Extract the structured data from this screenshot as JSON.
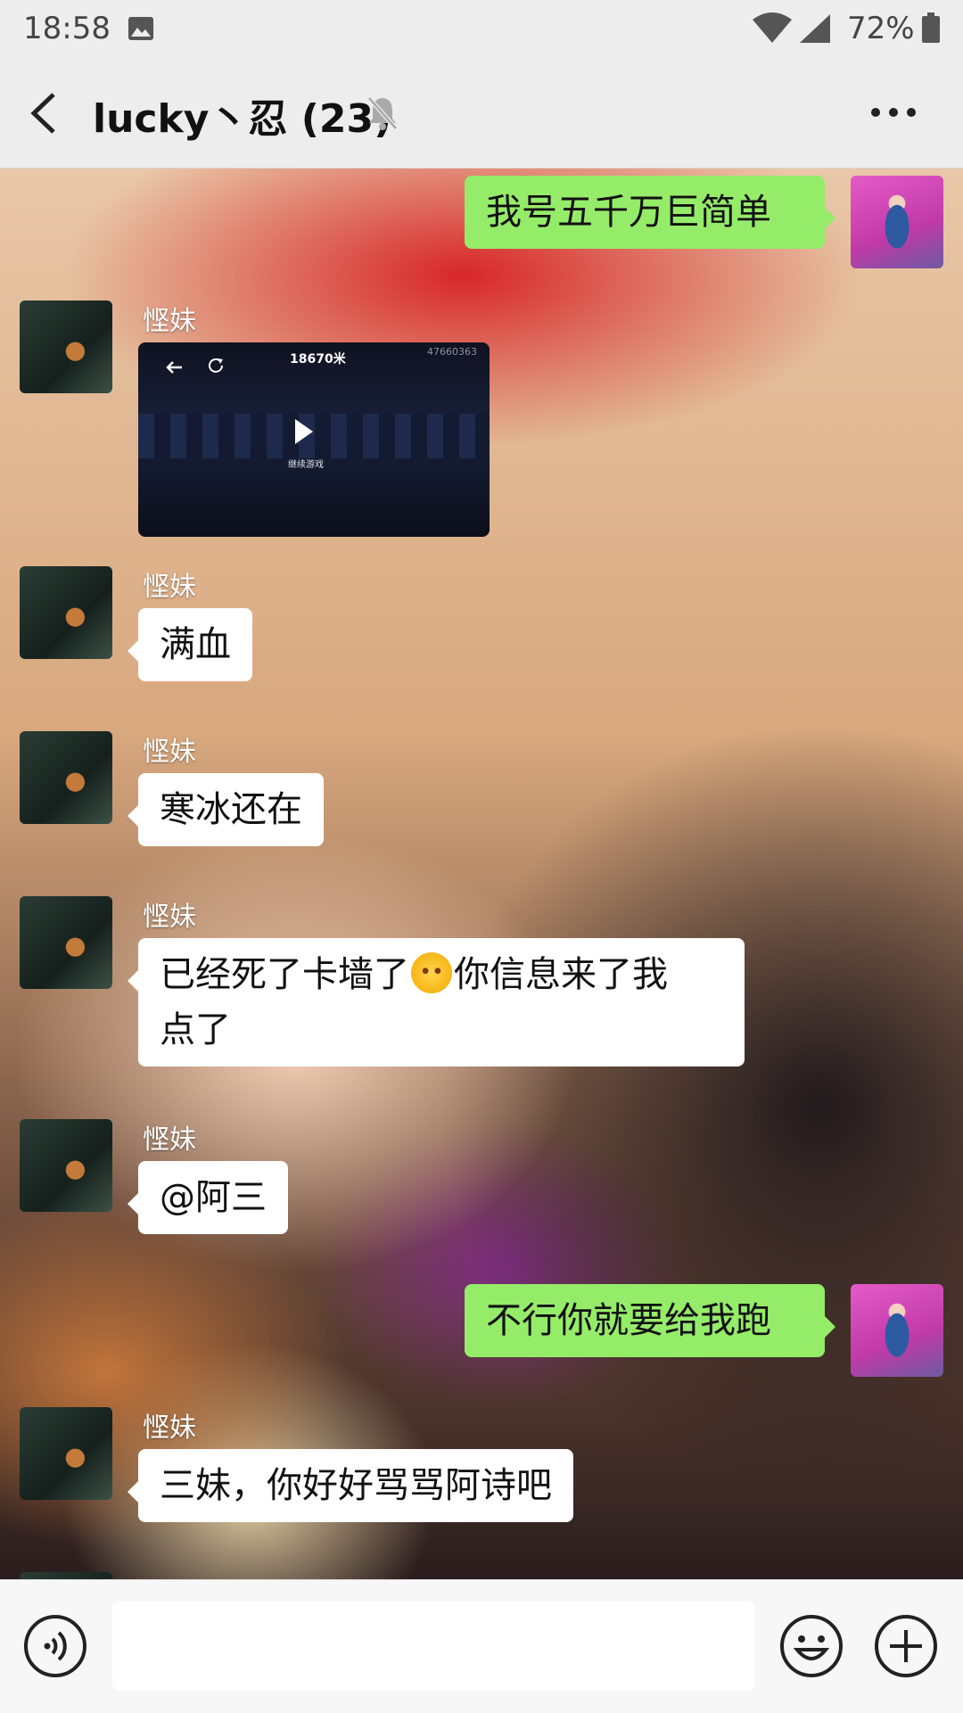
{
  "status_bar": {
    "time": "18:58",
    "battery": "72%",
    "icons": [
      "image-icon",
      "wifi-icon",
      "signal-icon",
      "battery-icon"
    ]
  },
  "header": {
    "title": "lucky丶忍 (23)",
    "icons": [
      "back-icon",
      "mute-icon",
      "more-icon"
    ]
  },
  "messages": [
    {
      "side": "right",
      "text": "我号五千万巨简单"
    },
    {
      "side": "left",
      "sender": "悭妹",
      "type": "video",
      "distance": "18670米",
      "code": "47660363",
      "caption": "继续游戏"
    },
    {
      "side": "left",
      "sender": "悭妹",
      "text": "满血"
    },
    {
      "side": "left",
      "sender": "悭妹",
      "text": "寒冰还在"
    },
    {
      "side": "left",
      "sender": "悭妹",
      "text_before_emoji": "已经死了卡墙了",
      "emoji": "pleading-face-emoji",
      "text_after_emoji": "你信息来了我",
      "text_line2": "点了"
    },
    {
      "side": "left",
      "sender": "悭妹",
      "text": "@阿三"
    },
    {
      "side": "right",
      "text": "不行你就要给我跑"
    },
    {
      "side": "left",
      "sender": "悭妹",
      "text": "三妹，你好好骂骂阿诗吧"
    }
  ],
  "input_bar": {
    "value": "",
    "icons": [
      "voice-icon",
      "emoji-icon",
      "plus-icon"
    ]
  },
  "colors": {
    "sent_bubble": "#95ec69",
    "received_bubble": "#ffffff",
    "bar_background": "#ededed"
  }
}
